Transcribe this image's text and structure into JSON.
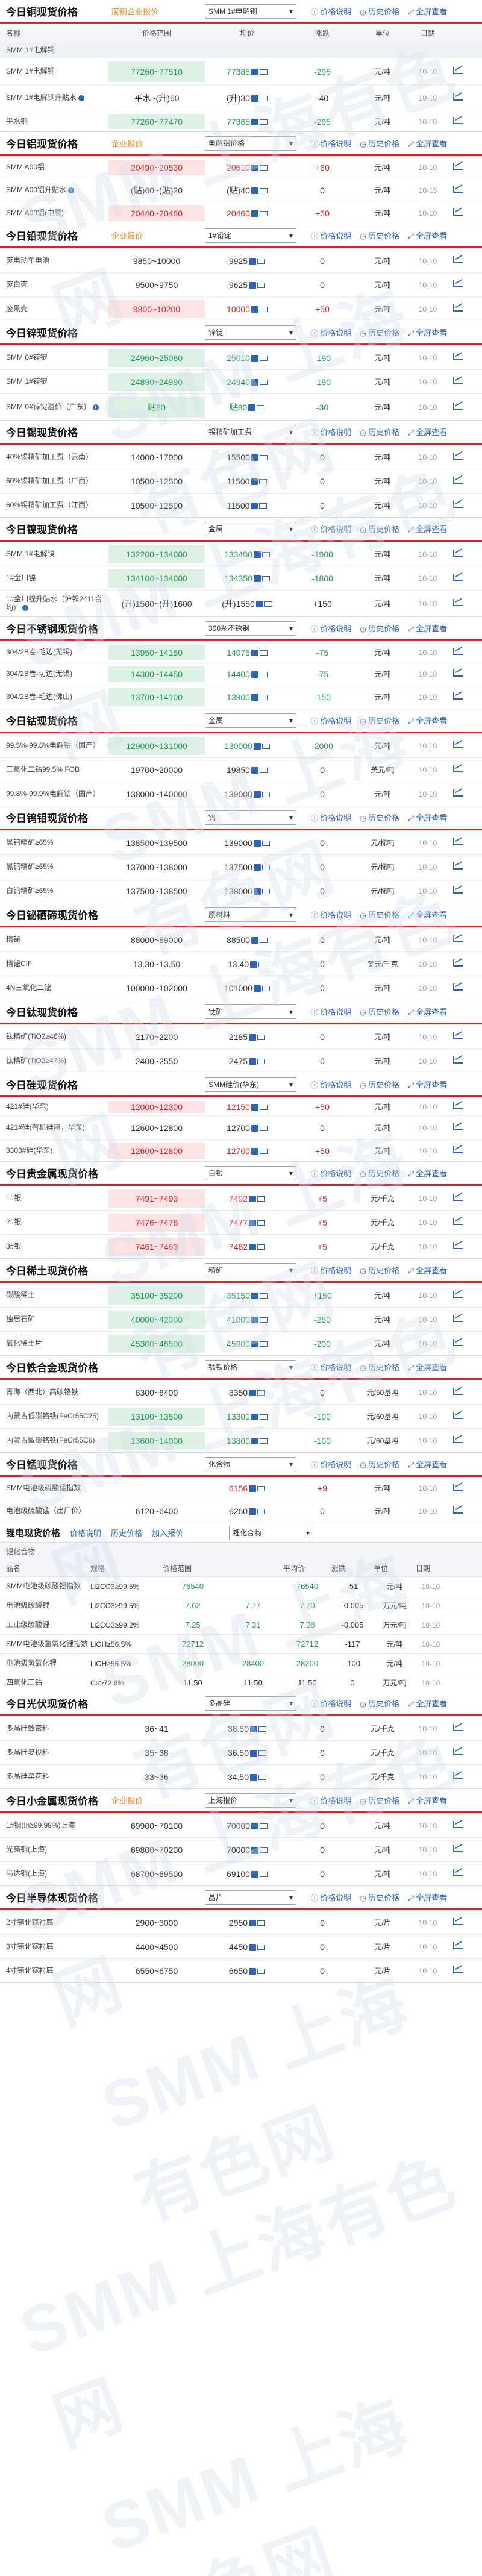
{
  "ui": {
    "price_desc": "价格说明",
    "history": "历史价格",
    "portfolio": "全屏查看",
    "add_price": "加入报价",
    "cols": [
      "名称",
      "价格范围",
      "均价",
      "涨跌",
      "单位",
      "日期"
    ]
  },
  "sections": [
    {
      "title": "今日铜现货价格",
      "company": "废铜企业报价",
      "select": "SMM 1#电解铜",
      "group": "SMM 1#电解铜",
      "rows": [
        [
          "SMM 1#电解铜",
          "77260~77510",
          "77385",
          "-295",
          "元/吨",
          "10-10",
          "dn",
          false,
          44
        ],
        [
          "SMM 1#电解铜升贴水",
          "平水~(升)60",
          "(升)30",
          "-40",
          "元/吨",
          "10-10",
          "",
          true,
          44
        ],
        [
          "平水铜",
          "77260~77470",
          "77365",
          "-295",
          "元/吨",
          "10-10",
          "dn",
          false,
          34
        ]
      ]
    },
    {
      "title": "今日铝现货价格",
      "company": "企业报价",
      "select": "电解铝价格",
      "rows": [
        [
          "SMM A00铝",
          "20490~20530",
          "20510",
          "+60",
          "元/吨",
          "10-10",
          "up",
          false,
          36
        ],
        [
          "SMM A00铝升贴水",
          "(贴)60~(贴)20",
          "(贴)40",
          "0",
          "元/吨",
          "10-15",
          "",
          true,
          40
        ],
        [
          "SMM A00铝(中原)",
          "20440~20480",
          "20460",
          "+50",
          "元/吨",
          "10-10",
          "up",
          false,
          36
        ]
      ]
    },
    {
      "title": "今日铅现货价格",
      "company": "企业报价",
      "select": "1#铅锭",
      "rows": [
        [
          "废电动车电池",
          "9850~10000",
          "9925",
          "0",
          "元/吨",
          "10-10",
          "",
          false,
          40
        ],
        [
          "废白壳",
          "9500~9750",
          "9625",
          "0",
          "元/吨",
          "10-10",
          "",
          false,
          40
        ],
        [
          "废黑壳",
          "9800~10200",
          "10000",
          "+50",
          "元/吨",
          "10-10",
          "up",
          false,
          40
        ]
      ]
    },
    {
      "title": "今日锌现货价格",
      "company": "",
      "select": "锌锭",
      "rows": [
        [
          "SMM 0#锌锭",
          "24960~25060",
          "25010",
          "-190",
          "元/吨",
          "10-10",
          "dn",
          false,
          40
        ],
        [
          "SMM 1#锌锭",
          "24890~24990",
          "24940",
          "-190",
          "元/吨",
          "10-10",
          "dn",
          false,
          40
        ],
        [
          "SMM 0#锌锭溢价（广东）",
          "贴80",
          "贴80",
          "-30",
          "元/吨",
          "10-10",
          "dn",
          true,
          44
        ]
      ]
    },
    {
      "title": "今日锡现货价格",
      "company": "",
      "select": "锡精矿加工费",
      "rows": [
        [
          "40%锡精矿加工费（云南）",
          "14000~17000",
          "15500",
          "0",
          "元/吨",
          "10-10",
          "",
          false,
          40
        ],
        [
          "60%锡精矿加工费（广西）",
          "10500~12500",
          "11500",
          "0",
          "元/吨",
          "10-10",
          "",
          false,
          40
        ],
        [
          "60%锡精矿加工费（江西）",
          "10500~12500",
          "11500",
          "0",
          "元/吨",
          "10-10",
          "",
          false,
          40
        ]
      ]
    },
    {
      "title": "今日镍现货价格",
      "company": "",
      "select": "金属",
      "rows": [
        [
          "SMM 1#电解镍",
          "132200~134600",
          "133400",
          "-1900",
          "元/吨",
          "10-10",
          "dn",
          false,
          40
        ],
        [
          "1#金川镍",
          "134100~134600",
          "134350",
          "-1800",
          "元/吨",
          "10-10",
          "dn",
          false,
          40
        ],
        [
          "1#金川镍升贴水（沪镍2411合约）",
          "(升)1500~(升)1600",
          "(升)1550",
          "+150",
          "元/吨",
          "10-10",
          "",
          true,
          44
        ]
      ]
    },
    {
      "title": "今日不锈钢现货价格",
      "company": "",
      "select": "300系不锈钢",
      "rows": [
        [
          "304/2B卷-毛边(无锡)",
          "13950~14150",
          "14075",
          "-75",
          "元/吨",
          "10-10",
          "dn",
          false,
          36
        ],
        [
          "304/2B卷-切边(无锡)",
          "14300~14450",
          "14400",
          "-75",
          "元/吨",
          "10-10",
          "dn",
          false,
          36
        ],
        [
          "304/2B卷-毛边(佛山)",
          "13700~14100",
          "13900",
          "-150",
          "元/吨",
          "10-10",
          "dn",
          false,
          40
        ]
      ]
    },
    {
      "title": "今日钴现货价格",
      "company": "",
      "select": "金属",
      "rows": [
        [
          "99.5%-99.8%电解钴（国产）",
          "129000~131000",
          "130000",
          "-2000",
          "元/吨",
          "10-10",
          "dn",
          false,
          40
        ],
        [
          "三氧化二钴99.5% FOB",
          "19700~20000",
          "19850",
          "0",
          "美元/吨",
          "10-10",
          "",
          false,
          40
        ],
        [
          "99.8%-99.9%电解钴（国产）",
          "138000~140000",
          "139000",
          "0",
          "元/吨",
          "10-10",
          "",
          false,
          40
        ]
      ]
    },
    {
      "title": "今日钨钼现货价格",
      "company": "",
      "select": "钨",
      "rows": [
        [
          "黑钨精矿≥65%",
          "138500~139500",
          "139000",
          "0",
          "元/标吨",
          "10-10",
          "",
          false,
          40
        ],
        [
          "黑钨精矿≥65%",
          "137000~138000",
          "137500",
          "0",
          "元/标吨",
          "10-10",
          "",
          false,
          40
        ],
        [
          "白钨精矿≥65%",
          "137500~138500",
          "138000",
          "0",
          "元/标吨",
          "10-10",
          "",
          false,
          40
        ]
      ]
    },
    {
      "title": "今日铋硒碲现货价格",
      "company": "",
      "select": "原材料",
      "rows": [
        [
          "精铋",
          "88000~89000",
          "88500",
          "0",
          "元/吨",
          "10-10",
          "",
          false,
          40
        ],
        [
          "精铋CIF",
          "13.30~13.50",
          "13.40",
          "0",
          "美元/千克",
          "10-10",
          "",
          false,
          40
        ],
        [
          "4N三氧化二铋",
          "100000~102000",
          "101000",
          "0",
          "元/吨",
          "10-10",
          "",
          false,
          40
        ]
      ]
    },
    {
      "title": "今日钛现货价格",
      "company": "",
      "select": "钛矿",
      "rows": [
        [
          "钛精矿(TiO2≥46%)",
          "2170~2200",
          "2185",
          "0",
          "元/吨",
          "10-10",
          "",
          false,
          40
        ],
        [
          "钛精矿(TiO2≥47%)",
          "2400~2550",
          "2475",
          "0",
          "元/吨",
          "10-10",
          "",
          false,
          40
        ]
      ]
    },
    {
      "title": "今日硅现货价格",
      "company": "",
      "select": "SMM硅价(华东)",
      "rows": [
        [
          "421#硅(华东)",
          "12000~12300",
          "12150",
          "+50",
          "元/吨",
          "10-10",
          "up",
          false,
          30
        ],
        [
          "421#硅(有机硅用，华东)",
          "12600~12800",
          "12700",
          "0",
          "元/吨",
          "10-10",
          "",
          false,
          40
        ],
        [
          "3303#硅(华东)",
          "12600~12800",
          "12700",
          "+50",
          "元/吨",
          "10-10",
          "up",
          false,
          36
        ]
      ]
    },
    {
      "title": "今日贵金属现货价格",
      "company": "",
      "select": "白银",
      "rows": [
        [
          "1#银",
          "7491~7493",
          "7492",
          "+5",
          "元/千克",
          "10-10",
          "up",
          false,
          40
        ],
        [
          "2#银",
          "7476~7478",
          "7477",
          "+5",
          "元/千克",
          "10-10",
          "up",
          false,
          40
        ],
        [
          "3#银",
          "7461~7463",
          "7462",
          "+5",
          "元/千克",
          "10-10",
          "up",
          false,
          40
        ]
      ]
    },
    {
      "title": "今日稀土现货价格",
      "company": "",
      "select": "精矿",
      "rows": [
        [
          "碳酸稀土",
          "35100~35200",
          "35150",
          "+150",
          "元/吨",
          "10-10",
          "dn",
          false,
          40
        ],
        [
          "独居石矿",
          "40000~42000",
          "41000",
          "-250",
          "元/吨",
          "10-10",
          "dn",
          false,
          40
        ],
        [
          "氧化稀土片",
          "45300~46500",
          "45900",
          "-200",
          "元/吨",
          "10-10",
          "dn",
          false,
          40
        ]
      ]
    },
    {
      "title": "今日铁合金现货价格",
      "company": "",
      "select": "锰铁价格",
      "rows": [
        [
          "青海（西北）高碳铬铁",
          "8300~8400",
          "8350",
          "0",
          "元/50基吨",
          "10-10",
          "",
          false,
          40
        ],
        [
          "内蒙古低碳铬铁(FeCr55C25)",
          "13100~13500",
          "13300",
          "-100",
          "元/60基吨",
          "10-10",
          "dn",
          false,
          40
        ],
        [
          "内蒙古微碳铬铁(FeCr55C6)",
          "13600~14000",
          "13800",
          "-100",
          "元/60基吨",
          "10-10",
          "dn",
          false,
          40
        ]
      ]
    },
    {
      "title": "今日锰现货价格",
      "company": "",
      "select": "化合物",
      "rows": [
        [
          "SMM电池级硫酸锰指数",
          "",
          "6156",
          "+9",
          "元/吨",
          "10-10",
          "up",
          false,
          36
        ],
        [
          "电池级硫酸锰（出厂价）",
          "6120~6400",
          "6260",
          "0",
          "元/吨",
          "10-10",
          "",
          false,
          40
        ]
      ]
    }
  ],
  "lithium": {
    "title": "锂电现货价格",
    "select": "锂化合物",
    "sub": "锂化合物",
    "cols": [
      "品名",
      "规格",
      "价格范围",
      "",
      "平均价",
      "涨跌",
      "单位",
      "日期"
    ],
    "rows": [
      [
        "SMM电池级碳酸锂指数",
        "Li2CO3≥99.5%",
        "76540",
        "",
        "76540",
        "-51",
        "元/吨",
        "10-10"
      ],
      [
        "电池级碳酸锂",
        "Li2CO3≥99.5%",
        "7.62",
        "7.77",
        "7.70",
        "-0.005",
        "万元/吨",
        "10-10"
      ],
      [
        "工业级碳酸锂",
        "Li2CO3≥99.2%",
        "7.25",
        "7.31",
        "7.28",
        "-0.005",
        "万元/吨",
        "10-10"
      ],
      [
        "SMM电池级氢氧化锂指数",
        "LiOH≥56.5%",
        "72712",
        "",
        "72712",
        "-117",
        "元/吨",
        "10-10"
      ],
      [
        "电池级氢氧化锂",
        "LiOH≥56.5%",
        "28000",
        "28400",
        "28200",
        "-100",
        "元/吨",
        "10-10"
      ],
      [
        "四氧化三钴",
        "Co≥72.6%",
        "11.50",
        "11.50",
        "11.50",
        "0",
        "万元/吨",
        "10-10"
      ]
    ]
  },
  "pv": {
    "title": "今日光伏现货价格",
    "select": "多晶硅",
    "rows": [
      [
        "多晶硅致密料",
        "36~41",
        "38.50",
        "0",
        "元/千克",
        "10-10",
        "",
        false,
        40
      ],
      [
        "多晶硅复投料",
        "35~38",
        "36.50",
        "0",
        "元/千克",
        "10-10",
        "",
        false,
        40
      ],
      [
        "多晶硅菜花料",
        "33~36",
        "34.50",
        "0",
        "元/千克",
        "10-10",
        "",
        false,
        40
      ]
    ]
  },
  "minor": {
    "title": "今日小金属现货价格",
    "company": "企业报价",
    "select": "上海报价",
    "rows": [
      [
        "1#铟(In≥99.99%)上海",
        "69900~70100",
        "70000",
        "0",
        "元/吨",
        "10-10",
        "",
        false,
        40
      ],
      [
        "光亮铜(上海)",
        "69800~70200",
        "70000",
        "0",
        "元/吨",
        "10-10",
        "",
        false,
        40
      ],
      [
        "马达铜(上海)",
        "68700~69500",
        "69100",
        "0",
        "元/吨",
        "10-10",
        "",
        false,
        40
      ]
    ]
  },
  "semi": {
    "title": "今日半导体现货价格",
    "select": "晶片",
    "rows": [
      [
        "2寸锗化镓衬底",
        "2900~3000",
        "2950",
        "0",
        "元/片",
        "10-10",
        "",
        false,
        40
      ],
      [
        "3寸锗化镓衬底",
        "4400~4500",
        "4450",
        "0",
        "元/片",
        "10-10",
        "",
        false,
        40
      ],
      [
        "4寸锗化镓衬底",
        "6550~6750",
        "6650",
        "0",
        "元/片",
        "10-10",
        "",
        false,
        40
      ]
    ]
  }
}
